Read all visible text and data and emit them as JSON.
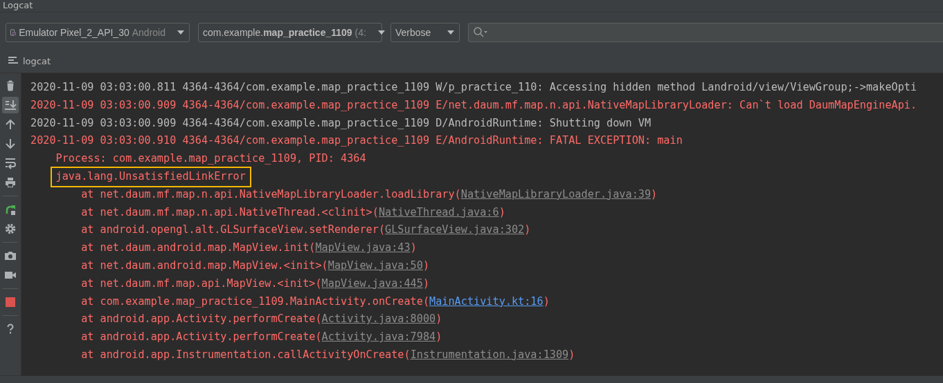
{
  "window": {
    "title": "Logcat"
  },
  "toolbar": {
    "device": {
      "label": "Emulator Pixel_2_API_30",
      "suffix": "Android"
    },
    "process": {
      "prefix": "com.example.",
      "name": "map_practice_1109",
      "suffix": "(4:"
    },
    "log_level": {
      "value": "Verbose"
    }
  },
  "panel_tab": {
    "label": "logcat"
  },
  "side_tools": [
    {
      "kind": "trash",
      "selected": false
    },
    {
      "kind": "scroll-end",
      "selected": true
    },
    {
      "kind": "up",
      "selected": false
    },
    {
      "kind": "down",
      "selected": false
    },
    {
      "kind": "wrap",
      "selected": false
    },
    {
      "kind": "print",
      "selected": false
    },
    {
      "kind": "separator"
    },
    {
      "kind": "restart",
      "selected": false
    },
    {
      "kind": "settings",
      "selected": false
    },
    {
      "kind": "separator"
    },
    {
      "kind": "camera",
      "selected": false
    },
    {
      "kind": "video",
      "selected": false
    },
    {
      "kind": "separator"
    },
    {
      "kind": "stop",
      "selected": false
    },
    {
      "kind": "separator"
    },
    {
      "kind": "help",
      "selected": false
    }
  ],
  "log_lines": [
    {
      "kind": "entry",
      "color": "#bbbbbb",
      "text": "2020-11-09 03:03:00.811 4364-4364/com.example.map_practice_1109 W/p_practice_110: Accessing hidden method Landroid/view/ViewGroup;->makeOpti"
    },
    {
      "kind": "entry",
      "color": "#ff6b68",
      "text": "2020-11-09 03:03:00.909 4364-4364/com.example.map_practice_1109 E/net.daum.mf.map.n.api.NativeMapLibraryLoader: Can`t load DaumMapEngineApi."
    },
    {
      "kind": "entry",
      "color": "#bbbbbb",
      "text": "2020-11-09 03:03:00.909 4364-4364/com.example.map_practice_1109 D/AndroidRuntime: Shutting down VM"
    },
    {
      "kind": "entry",
      "color": "#ff6b68",
      "text": "2020-11-09 03:03:00.910 4364-4364/com.example.map_practice_1109 E/AndroidRuntime: FATAL EXCEPTION: main"
    },
    {
      "kind": "detail",
      "color": "#ff6b68",
      "text": "Process: com.example.map_practice_1109, PID: 4364",
      "highlighted": false
    },
    {
      "kind": "detail",
      "color": "#ff6b68",
      "text": "java.lang.UnsatisfiedLinkError",
      "highlighted": true
    },
    {
      "kind": "stack",
      "color": "#ff6b68",
      "text": "at net.daum.mf.map.n.api.NativeMapLibraryLoader.loadLibrary(",
      "link": "NativeMapLibraryLoader.java:39",
      "project": false,
      "tail": ")"
    },
    {
      "kind": "stack",
      "color": "#ff6b68",
      "text": "at net.daum.mf.map.n.api.NativeThread.<clinit>(",
      "link": "NativeThread.java:6",
      "project": false,
      "tail": ")"
    },
    {
      "kind": "stack",
      "color": "#ff6b68",
      "text": "at android.opengl.alt.GLSurfaceView.setRenderer(",
      "link": "GLSurfaceView.java:302",
      "project": false,
      "tail": ")"
    },
    {
      "kind": "stack",
      "color": "#ff6b68",
      "text": "at net.daum.android.map.MapView.init(",
      "link": "MapView.java:43",
      "project": false,
      "tail": ")"
    },
    {
      "kind": "stack",
      "color": "#ff6b68",
      "text": "at net.daum.android.map.MapView.<init>(",
      "link": "MapView.java:50",
      "project": false,
      "tail": ")"
    },
    {
      "kind": "stack",
      "color": "#ff6b68",
      "text": "at net.daum.mf.map.api.MapView.<init>(",
      "link": "MapView.java:445",
      "project": false,
      "tail": ")"
    },
    {
      "kind": "stack",
      "color": "#ff6b68",
      "text": "at com.example.map_practice_1109.MainActivity.onCreate(",
      "link": "MainActivity.kt:16",
      "project": true,
      "tail": ")"
    },
    {
      "kind": "stack",
      "color": "#ff6b68",
      "text": "at android.app.Activity.performCreate(",
      "link": "Activity.java:8000",
      "project": false,
      "tail": ")"
    },
    {
      "kind": "stack",
      "color": "#ff6b68",
      "text": "at android.app.Activity.performCreate(",
      "link": "Activity.java:7984",
      "project": false,
      "tail": ")"
    },
    {
      "kind": "stack",
      "color": "#ff6b68",
      "text": "at android.app.Instrumentation.callActivityOnCreate(",
      "link": "Instrumentation.java:1309",
      "project": false,
      "tail": ")"
    }
  ]
}
